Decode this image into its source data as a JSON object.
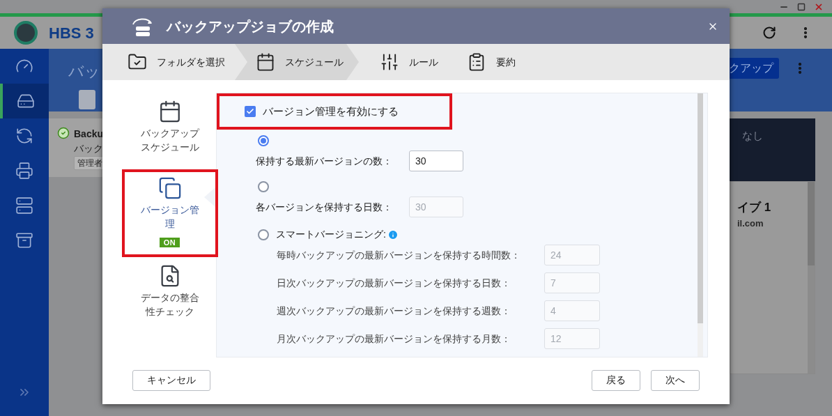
{
  "background": {
    "app_title": "HBS 3",
    "sidebar": [
      {
        "selected": false
      },
      {
        "selected": true
      },
      {
        "selected": false
      },
      {
        "selected": false
      },
      {
        "selected": false
      },
      {
        "selected": false
      }
    ],
    "page_title": "バッ",
    "job": {
      "name": "Backu",
      "description": "バック",
      "tag": "管理者"
    },
    "action_button": "クアップ",
    "panel_text": "なし",
    "card_title": "イブ 1",
    "card_email": "il.com"
  },
  "dialog": {
    "title": "バックアップジョブの作成",
    "steps": [
      {
        "label": "フォルダを選択",
        "selected": false
      },
      {
        "label": "スケジュール",
        "selected": true
      },
      {
        "label": "ルール",
        "selected": false
      },
      {
        "label": "要約",
        "selected": false
      }
    ],
    "nav": [
      {
        "label": "バックアップスケジュール",
        "selected": false,
        "highlighted": false
      },
      {
        "label": "バージョン管理",
        "selected": true,
        "highlighted": true,
        "badge": "ON"
      },
      {
        "label": "データの整合性チェック",
        "selected": false,
        "highlighted": false
      }
    ],
    "enable_versioning": {
      "label": "バージョン管理を有効にする",
      "checked": true,
      "highlighted": true
    },
    "options": [
      {
        "kind": "count",
        "selected": true,
        "label": "保持する最新バージョンの数：",
        "value": "30",
        "disabled": false
      },
      {
        "kind": "count",
        "selected": false,
        "label": "各バージョンを保持する日数：",
        "value": "30",
        "disabled": true
      },
      {
        "kind": "smart",
        "selected": false,
        "label": "スマートバージョニング:",
        "rules": [
          {
            "label": "毎時バックアップの最新バージョンを保持する時間数：",
            "value": "24",
            "disabled": true
          },
          {
            "label": "日次バックアップの最新バージョンを保持する日数：",
            "value": "7",
            "disabled": true
          },
          {
            "label": "週次バックアップの最新バージョンを保持する週数：",
            "value": "4",
            "disabled": true
          },
          {
            "label": "月次バックアップの最新バージョンを保持する月数：",
            "value": "12",
            "disabled": true
          }
        ]
      }
    ],
    "buttons": {
      "cancel": "キャンセル",
      "back": "戻る",
      "next": "次へ"
    }
  }
}
